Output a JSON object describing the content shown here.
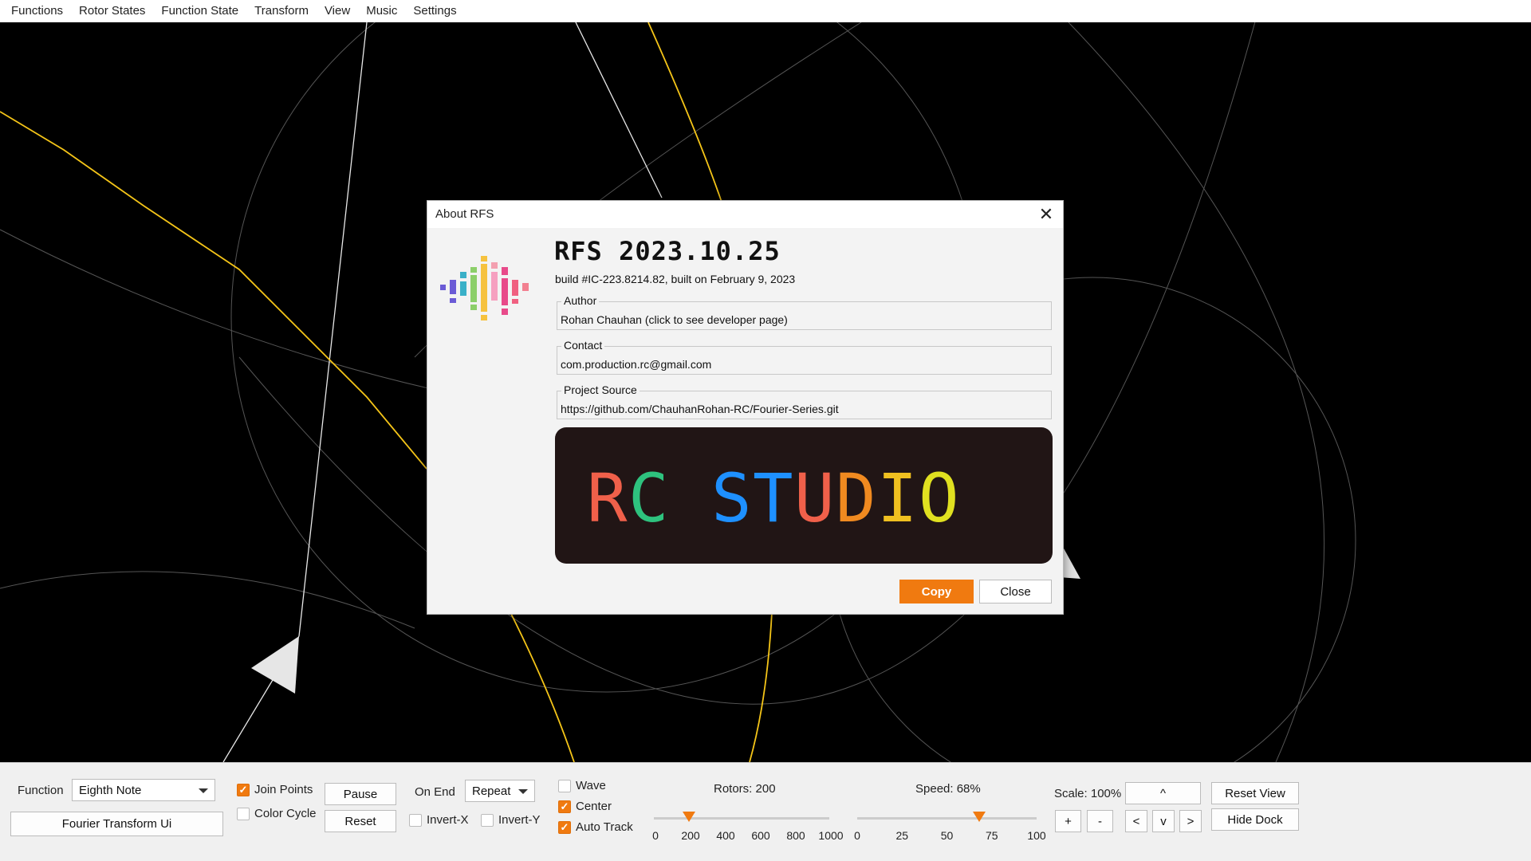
{
  "menubar": {
    "items": [
      "Functions",
      "Rotor States",
      "Function State",
      "Transform",
      "View",
      "Music",
      "Settings"
    ]
  },
  "dialog": {
    "title": "About RFS",
    "app_name": "RFS 2023.10.25",
    "build_info": "build #IC-223.8214.82, built on February 9, 2023",
    "author_label": "Author",
    "author_value": "Rohan Chauhan (click to see developer page)",
    "contact_label": "Contact",
    "contact_value": "com.production.rc@gmail.com",
    "source_label": "Project Source",
    "source_value": "https://github.com/ChauhanRohan-RC/Fourier-Series.git",
    "banner_text": "RC STUDIO",
    "banner_colors": [
      "#f0604a",
      "#2ec27e",
      "#1e90ff",
      "#1e90ff",
      "#f0604a",
      "#f08a20",
      "#f0c020",
      "#e0e020",
      "#e84a8a"
    ],
    "copy_label": "Copy",
    "close_label": "Close",
    "accent": "#f07a10"
  },
  "dock": {
    "function_label": "Function",
    "function_value": "Eighth Note",
    "fourier_button": "Fourier Transform Ui",
    "join_points": {
      "label": "Join Points",
      "checked": true
    },
    "color_cycle": {
      "label": "Color Cycle",
      "checked": false
    },
    "pause_label": "Pause",
    "reset_label": "Reset",
    "on_end_label": "On End",
    "on_end_value": "Repeat",
    "invert_x": {
      "label": "Invert-X",
      "checked": false
    },
    "invert_y": {
      "label": "Invert-Y",
      "checked": false
    },
    "wave": {
      "label": "Wave",
      "checked": false
    },
    "center": {
      "label": "Center",
      "checked": true
    },
    "auto_track": {
      "label": "Auto Track",
      "checked": true
    },
    "rotors_label": "Rotors: 200",
    "rotors_value": 200,
    "rotors_range": [
      0,
      1000
    ],
    "rotors_ticks": [
      "0",
      "200",
      "400",
      "600",
      "800",
      "1000"
    ],
    "speed_label": "Speed: 68%",
    "speed_value": 68,
    "speed_range": [
      0,
      100
    ],
    "speed_ticks": [
      "0",
      "25",
      "50",
      "75",
      "100"
    ],
    "scale_label": "Scale: 100%",
    "up_label": "^",
    "plus_label": "+",
    "minus_label": "-",
    "left_label": "<",
    "down_label": "v",
    "right_label": ">",
    "reset_view_label": "Reset View",
    "hide_dock_label": "Hide Dock"
  }
}
